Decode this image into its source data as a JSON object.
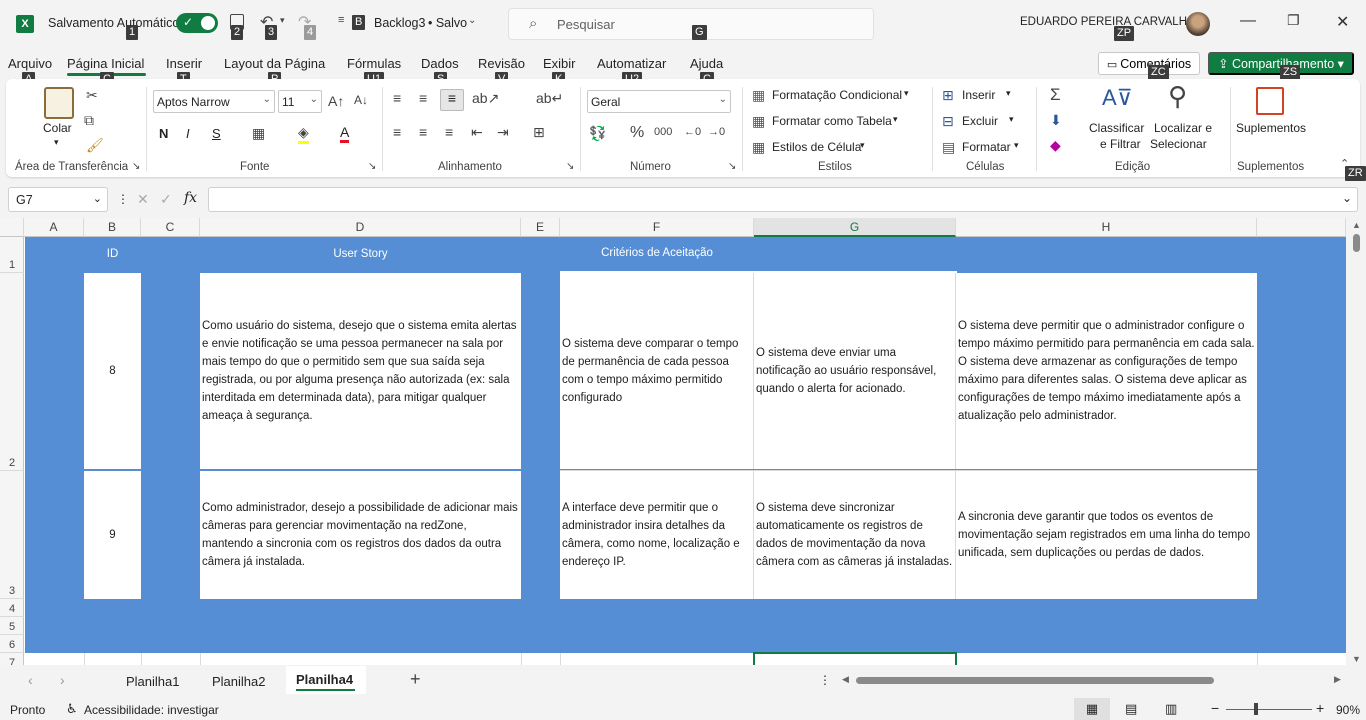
{
  "titlebar": {
    "autosave_label": "Salvamento Automático",
    "doc_name": "Backlog3",
    "saved_state": "• Salvo",
    "search_placeholder": "Pesquisar",
    "user_name": "EDUARDO PEREIRA CARVALHO"
  },
  "tabs": [
    "Arquivo",
    "Página Inicial",
    "Inserir",
    "Layout da Página",
    "Fórmulas",
    "Dados",
    "Revisão",
    "Exibir",
    "Automatizar",
    "Ajuda"
  ],
  "active_tab": "Página Inicial",
  "comments_label": "Comentários",
  "share_label": "Compartilhamento",
  "keytips": {
    "autosave": "1",
    "save": "2",
    "undo": "3",
    "redo": "4",
    "doc": "B",
    "search": "G",
    "arquivo": "A",
    "inicial": "C",
    "inserir": "T",
    "layout": "P",
    "formulas": "U1",
    "dados": "S",
    "revisao": "V",
    "exibir": "K",
    "automatizar": "U2",
    "ajuda": "Ç",
    "profile": "ZP",
    "comments": "ZC",
    "share": "ZS",
    "collapse": "ZR"
  },
  "ribbon": {
    "clipboard": {
      "paste": "Colar",
      "label": "Área de Transferência"
    },
    "font": {
      "name": "Aptos Narrow",
      "size": "11",
      "bold": "N",
      "italic": "I",
      "underline": "S",
      "label": "Fonte"
    },
    "alignment": {
      "label": "Alinhamento"
    },
    "number": {
      "format": "Geral",
      "label": "Número"
    },
    "styles": {
      "conditional": "Formatação Condicional",
      "as_table": "Formatar como Tabela",
      "cell_styles": "Estilos de Célula",
      "label": "Estilos"
    },
    "cells": {
      "insert": "Inserir",
      "delete": "Excluir",
      "format": "Formatar",
      "label": "Células"
    },
    "editing": {
      "sort_line1": "Classificar",
      "sort_line2": "e Filtrar",
      "find_line1": "Localizar e",
      "find_line2": "Selecionar",
      "label": "Edição"
    },
    "addins": {
      "btn": "Suplementos",
      "label": "Suplementos"
    }
  },
  "formula_bar": {
    "namebox": "G7",
    "fx": "fx",
    "value": ""
  },
  "columns": [
    "A",
    "B",
    "C",
    "D",
    "E",
    "F",
    "G",
    "H"
  ],
  "selected_column": "G",
  "rows": [
    "1",
    "2",
    "3",
    "4",
    "5",
    "6",
    "7"
  ],
  "table": {
    "header_id": "ID",
    "header_story": "User Story",
    "header_criteria": "Critérios de Aceitação",
    "row2": {
      "id": "8",
      "story": "Como usuário do sistema, desejo que o sistema emita alertas e envie notificação se uma pessoa permanecer na sala por mais tempo do que o permitido sem que sua saída seja registrada, ou por alguma presença não autorizada (ex: sala interditada em determinada data), para mitigar qualquer ameaça à segurança.",
      "f": "O sistema deve comparar o tempo de permanência de cada pessoa com o tempo máximo permitido configurado",
      "g": "O sistema deve enviar uma notificação ao usuário responsável, quando o alerta for acionado.",
      "h": " O sistema deve permitir que o administrador configure o tempo máximo permitido para permanência em cada sala.  O sistema deve armazenar as configurações de tempo máximo para diferentes salas.  O sistema deve aplicar as configurações de tempo máximo imediatamente após a atualização pelo administrador."
    },
    "row3": {
      "id": "9",
      "story": "Como administrador, desejo a possibilidade de adicionar mais câmeras para gerenciar movimentação na redZone, mantendo a sincronia com os registros dos dados da outra câmera já instalada.",
      "f": "A interface deve permitir que o administrador insira detalhes da câmera, como nome, localização e endereço IP.",
      "g": "O sistema deve sincronizar automaticamente os registros de dados de movimentação da nova câmera com as câmeras já instaladas.",
      "h": "A sincronia deve garantir que todos os eventos de movimentação sejam registrados em uma linha do tempo unificada, sem duplicações ou perdas de dados."
    }
  },
  "sheets": [
    "Planilha1",
    "Planilha2",
    "Planilha4"
  ],
  "active_sheet": "Planilha4",
  "status": {
    "ready": "Pronto",
    "accessibility": "Acessibilidade: investigar",
    "zoom": "90%"
  },
  "colors": {
    "accent": "#107c41",
    "table_blue": "#558ed5"
  }
}
